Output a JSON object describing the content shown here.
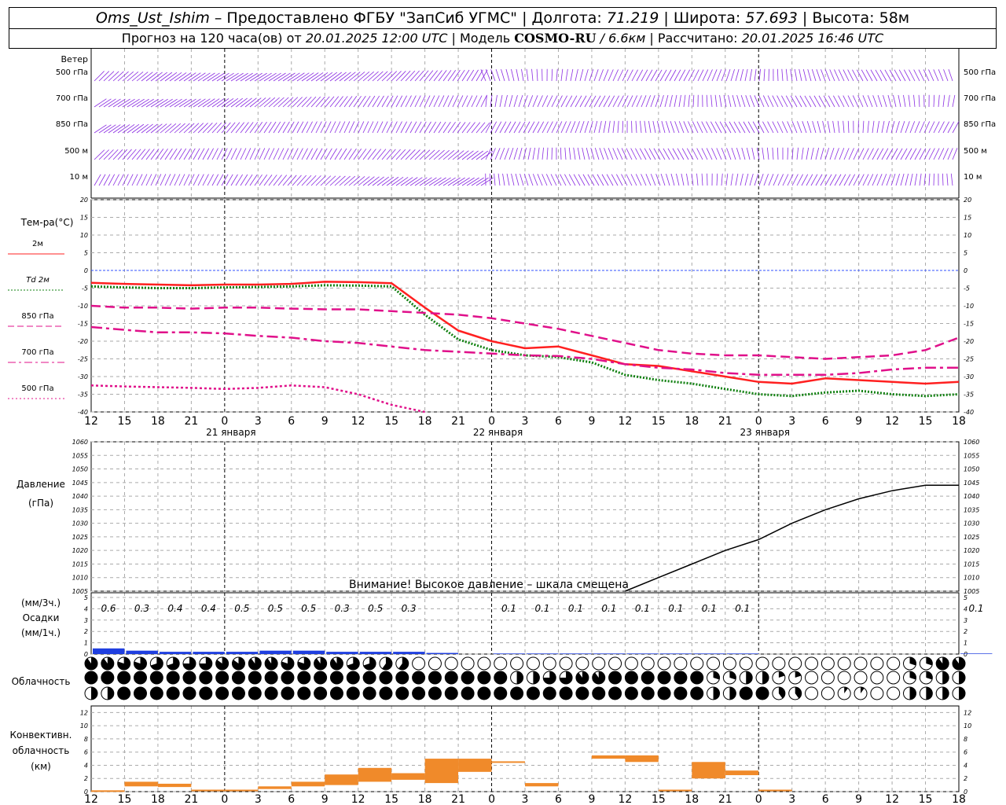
{
  "header": {
    "station": "Oms_Ust_Ishim",
    "provider": "– Предоставлено ФГБУ \"ЗапСиб УГМС\"",
    "lon_label": "| Долгота:",
    "lon": "71.219",
    "lat_label": "| Широта:",
    "lat": "57.693",
    "alt_label": "| Высота: 58м",
    "fc_label": "Прогноз на 120 часа(ов) от",
    "fc_start": "20.01.2025 12:00 UTC",
    "model_label": "| Модель",
    "model": "COSMO-RU",
    "model_res": "/ 6.6км",
    "calc_label": "| Рассчитано:",
    "calc_time": "20.01.2025 16:46 UTC"
  },
  "wind_panel": {
    "title": "Ветер",
    "levels": [
      "500 гПа",
      "700 гПа",
      "850 гПа",
      "500 м",
      "10  м"
    ]
  },
  "temp_panel": {
    "title": "Тем-ра(°C)",
    "legend": [
      {
        "label": "2м",
        "color": "#ff2020",
        "style": "solid"
      },
      {
        "label": "Td  2м",
        "color": "#108010",
        "style": "dotted"
      },
      {
        "label": "850 гПа",
        "color": "#e0108a",
        "style": "dash"
      },
      {
        "label": "700 гПа",
        "color": "#e0108a",
        "style": "dashdot"
      },
      {
        "label": "500 гПа",
        "color": "#e0108a",
        "style": "dot"
      }
    ],
    "y_ticks": [
      20,
      15,
      10,
      5,
      0,
      -5,
      -10,
      -15,
      -20,
      -25,
      -30,
      -35,
      -40
    ]
  },
  "time_axis": {
    "hour_labels": [
      "12",
      "15",
      "18",
      "21",
      "0",
      "3",
      "6",
      "9",
      "12",
      "15",
      "18",
      "21",
      "0",
      "3",
      "6",
      "9",
      "12",
      "15",
      "18",
      "21",
      "0",
      "3",
      "6",
      "9",
      "12",
      "15",
      "18"
    ],
    "day_labels": [
      "21 января",
      "22 января",
      "23 января"
    ]
  },
  "pressure_panel": {
    "title": "Давление",
    "unit": "(гПа)",
    "y_ticks": [
      1060,
      1055,
      1050,
      1045,
      1040,
      1035,
      1030,
      1025,
      1020,
      1015,
      1010,
      1005
    ],
    "warning": "Внимание! Высокое давление – шкала смещена"
  },
  "precip_panel": {
    "unit_3h": "(мм/3ч.)",
    "title": "Осадки",
    "unit_1h": "(мм/1ч.)",
    "y_ticks": [
      5,
      4,
      3,
      2,
      1,
      0
    ],
    "labels_3h": [
      "0.6",
      "0.3",
      "0.4",
      "0.4",
      "0.5",
      "0.5",
      "0.5",
      "0.3",
      "0.5",
      "0.3",
      "",
      "",
      "0.1",
      "0.1",
      "0.1",
      "0.1",
      "0.1",
      "0.1",
      "0.1",
      "0.1",
      "",
      "",
      "",
      "",
      "",
      "",
      "0.1"
    ]
  },
  "cloud_panel": {
    "title": "Облачность"
  },
  "conv_panel": {
    "title_1": "Конвективн.",
    "title_2": "облачность",
    "unit": "(км)",
    "y_ticks": [
      12,
      10,
      8,
      6,
      4,
      2,
      0
    ]
  },
  "chart_data": [
    {
      "type": "line",
      "title": "Тем-ра(°C)",
      "ylim": [
        -40,
        20
      ],
      "x": [
        0,
        3,
        6,
        9,
        12,
        15,
        18,
        21,
        24,
        27,
        30,
        33,
        36,
        39,
        42,
        45,
        48,
        51,
        54,
        57,
        60,
        63,
        66,
        69,
        72,
        75,
        78
      ],
      "series": [
        {
          "name": "2м",
          "values": [
            -3.5,
            -3.8,
            -4.0,
            -4.2,
            -4.0,
            -4.0,
            -3.8,
            -3.2,
            -3.3,
            -3.6,
            -10.5,
            -17,
            -20,
            -22,
            -21.5,
            -24,
            -26.5,
            -27,
            -28.5,
            -30,
            -31.5,
            -32,
            -30.5,
            -31,
            -31.5,
            -32,
            -31.5
          ]
        },
        {
          "name": "Td  2м",
          "values": [
            -4.5,
            -4.8,
            -5.0,
            -5.0,
            -4.8,
            -4.7,
            -4.5,
            -4.2,
            -4.3,
            -4.5,
            -12.5,
            -19.5,
            -22.5,
            -24,
            -24.5,
            -26,
            -29.5,
            -31,
            -32,
            -33.5,
            -35,
            -35.5,
            -34.5,
            -34,
            -35,
            -35.5,
            -35
          ]
        },
        {
          "name": "850 гПа",
          "values": [
            -10,
            -10.5,
            -10.5,
            -10.8,
            -10.5,
            -10.5,
            -10.8,
            -11,
            -11,
            -11.5,
            -12,
            -12.5,
            -13.5,
            -15,
            -16.5,
            -18.5,
            -20.5,
            -22.5,
            -23.5,
            -24,
            -24,
            -24.5,
            -25,
            -24.5,
            -24,
            -22.5,
            -19
          ]
        },
        {
          "name": "700 гПа",
          "values": [
            -16,
            -16.8,
            -17.5,
            -17.5,
            -17.8,
            -18.5,
            -19,
            -20,
            -20.5,
            -21.5,
            -22.5,
            -23,
            -23.5,
            -24,
            -24.2,
            -25,
            -26.5,
            -27.5,
            -28,
            -29,
            -29.5,
            -29.5,
            -29.5,
            -29,
            -28,
            -27.5,
            -27.5
          ]
        },
        {
          "name": "500 гПа",
          "values": [
            -32.5,
            -32.8,
            -33,
            -33.2,
            -33.5,
            -33.2,
            -32.5,
            -33,
            -35,
            -38,
            -40
          ]
        }
      ]
    },
    {
      "type": "line",
      "title": "Давление",
      "ylim": [
        1005,
        1060
      ],
      "x": [
        48,
        51,
        54,
        57,
        60,
        63,
        66,
        69,
        72,
        75,
        78
      ],
      "series": [
        {
          "name": "Давление",
          "values": [
            1005,
            1010,
            1015,
            1020,
            1024,
            1030,
            1035,
            1039,
            1042,
            1044,
            1044
          ]
        }
      ]
    },
    {
      "type": "bar",
      "title": "Осадки",
      "ylim": [
        0,
        5
      ],
      "x": [
        0,
        3,
        6,
        9,
        12,
        15,
        18,
        21,
        24,
        27,
        30,
        33,
        36,
        39,
        42,
        45,
        48,
        51,
        54,
        57,
        60,
        63,
        66,
        69,
        72,
        75,
        78
      ],
      "values": [
        0.5,
        0.3,
        0.2,
        0.2,
        0.2,
        0.3,
        0.3,
        0.2,
        0.2,
        0.2,
        0.1,
        0,
        0.05,
        0.05,
        0.05,
        0.05,
        0.05,
        0.05,
        0.05,
        0.05,
        0,
        0,
        0,
        0,
        0,
        0,
        0.05
      ]
    },
    {
      "type": "table",
      "title": "Облачность",
      "rows": [
        [
          0.9,
          0.8,
          0.7,
          0.75,
          0.85,
          0.9,
          0.8,
          0.9,
          0.7,
          0.6,
          0,
          0,
          0,
          0,
          0,
          0,
          0,
          0,
          0,
          0,
          0,
          0,
          0,
          0,
          0,
          0.3,
          0.9
        ],
        [
          1,
          1,
          1,
          1,
          1,
          1,
          1,
          1,
          1,
          1,
          1,
          1,
          1,
          0.5,
          0.75,
          0.9,
          1,
          1,
          1,
          0.3,
          0.5,
          0.2,
          0,
          0,
          0,
          0.3,
          0.5
        ],
        [
          0.5,
          1,
          1,
          1,
          1,
          1,
          1,
          1,
          1,
          1,
          1,
          1,
          1,
          1,
          1,
          1,
          1,
          1,
          1,
          0.5,
          1,
          0.4,
          0,
          0.1,
          0,
          0.5,
          0.5
        ]
      ]
    },
    {
      "type": "bar",
      "title": "Конвективн. облачность (км)",
      "ylim": [
        0,
        12
      ],
      "x": [
        0,
        3,
        6,
        9,
        12,
        15,
        18,
        21,
        24,
        27,
        30,
        33,
        36,
        39,
        42,
        45,
        48,
        51,
        54,
        57,
        60,
        63,
        66,
        69,
        72,
        75,
        78
      ],
      "bottoms": [
        0.2,
        0.8,
        0.7,
        0.3,
        0.3,
        0.4,
        0.8,
        1.0,
        1.5,
        1.8,
        1.3,
        3.0,
        4.5,
        0.8,
        0,
        5.0,
        4.5,
        0.2,
        2.0,
        2.5,
        0.3,
        0,
        0,
        0,
        0,
        0,
        0
      ],
      "tops": [
        0.2,
        1.5,
        1.2,
        0.3,
        0.3,
        0.8,
        1.5,
        2.6,
        3.6,
        2.8,
        5.0,
        5.0,
        4.6,
        1.3,
        0,
        5.5,
        5.5,
        0.3,
        4.5,
        3.2,
        0.3,
        0,
        0,
        0,
        0,
        0,
        0
      ]
    }
  ]
}
